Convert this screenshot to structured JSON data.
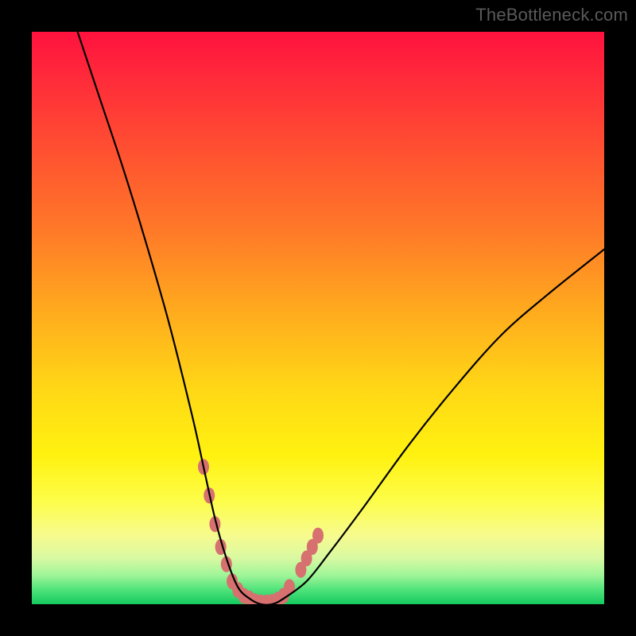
{
  "watermark": "TheBottleneck.com",
  "chart_data": {
    "type": "line",
    "title": "",
    "xlabel": "",
    "ylabel": "",
    "xlim": [
      0,
      100
    ],
    "ylim": [
      0,
      100
    ],
    "background_gradient": {
      "orientation": "vertical",
      "stops": [
        {
          "pos": 0,
          "color": "#ff123e"
        },
        {
          "pos": 22,
          "color": "#ff5430"
        },
        {
          "pos": 48,
          "color": "#ffa81e"
        },
        {
          "pos": 74,
          "color": "#fff210"
        },
        {
          "pos": 92,
          "color": "#d8f9a2"
        },
        {
          "pos": 100,
          "color": "#14c95e"
        }
      ]
    },
    "series": [
      {
        "name": "bottleneck-curve",
        "color": "#000000",
        "x": [
          8,
          12,
          16,
          20,
          24,
          28,
          30,
          32,
          34,
          36,
          38,
          40,
          42,
          44,
          48,
          52,
          58,
          66,
          74,
          82,
          90,
          100
        ],
        "y": [
          100,
          88,
          76,
          63,
          49,
          33,
          24,
          15,
          8,
          3,
          1,
          0,
          0,
          1,
          4,
          9,
          17,
          28,
          38,
          47,
          54,
          62
        ]
      }
    ],
    "highlight": {
      "name": "optimal-zone-markers",
      "color": "#d6716f",
      "points": [
        {
          "x": 30,
          "y": 24
        },
        {
          "x": 31,
          "y": 19
        },
        {
          "x": 32,
          "y": 14
        },
        {
          "x": 33,
          "y": 10
        },
        {
          "x": 34,
          "y": 7
        },
        {
          "x": 35,
          "y": 4
        },
        {
          "x": 36,
          "y": 2.5
        },
        {
          "x": 37,
          "y": 1.5
        },
        {
          "x": 38,
          "y": 1
        },
        {
          "x": 39,
          "y": 0.5
        },
        {
          "x": 40,
          "y": 0.3
        },
        {
          "x": 41,
          "y": 0.3
        },
        {
          "x": 42,
          "y": 0.4
        },
        {
          "x": 43,
          "y": 0.8
        },
        {
          "x": 44,
          "y": 1.5
        },
        {
          "x": 45,
          "y": 3
        },
        {
          "x": 47,
          "y": 6
        },
        {
          "x": 48,
          "y": 8
        },
        {
          "x": 49,
          "y": 10
        },
        {
          "x": 50,
          "y": 12
        }
      ]
    }
  }
}
